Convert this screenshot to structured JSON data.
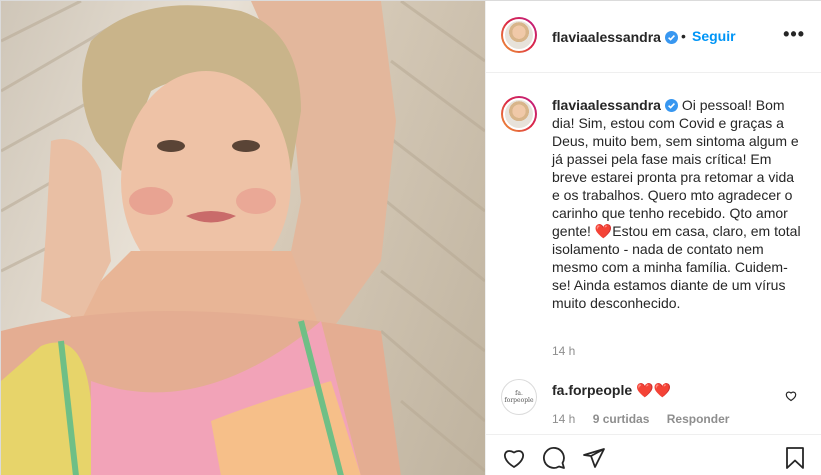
{
  "post": {
    "username": "flaviaalessandra",
    "follow_label": "Seguir",
    "dot": "•",
    "more_label": "•••"
  },
  "caption": {
    "username": "flaviaalessandra",
    "text_before_heart": "Oi pessoal! Bom dia! Sim, estou com Covid e graças a Deus, muito bem, sem sintoma algum e já passei pela fase mais crítica! Em breve estarei pronta pra retomar a vida e os trabalhos. Quero mto agradecer o carinho que tenho recebido. Qto amor gente! ",
    "heart": "❤️",
    "text_after_heart": "Estou em casa, claro, em total isolamento - nada de contato nem mesmo com a minha família. Cuidem-se! Ainda estamos diante de um vírus muito desconhecido.",
    "time": "14 h"
  },
  "comment": {
    "avatar_text": "fa. forpeople",
    "username": "fa.forpeople",
    "text": "❤️❤️",
    "time": "14 h",
    "likes": "9 curtidas",
    "reply_label": "Responder"
  },
  "colors": {
    "link": "#0095f6",
    "verified": "#3897f0",
    "heart": "#ed4956",
    "muted": "#8e8e8e"
  },
  "icons": [
    "verified-badge-icon",
    "more-options-icon",
    "like-icon",
    "comment-icon",
    "share-icon",
    "save-icon",
    "comment-like-icon"
  ]
}
